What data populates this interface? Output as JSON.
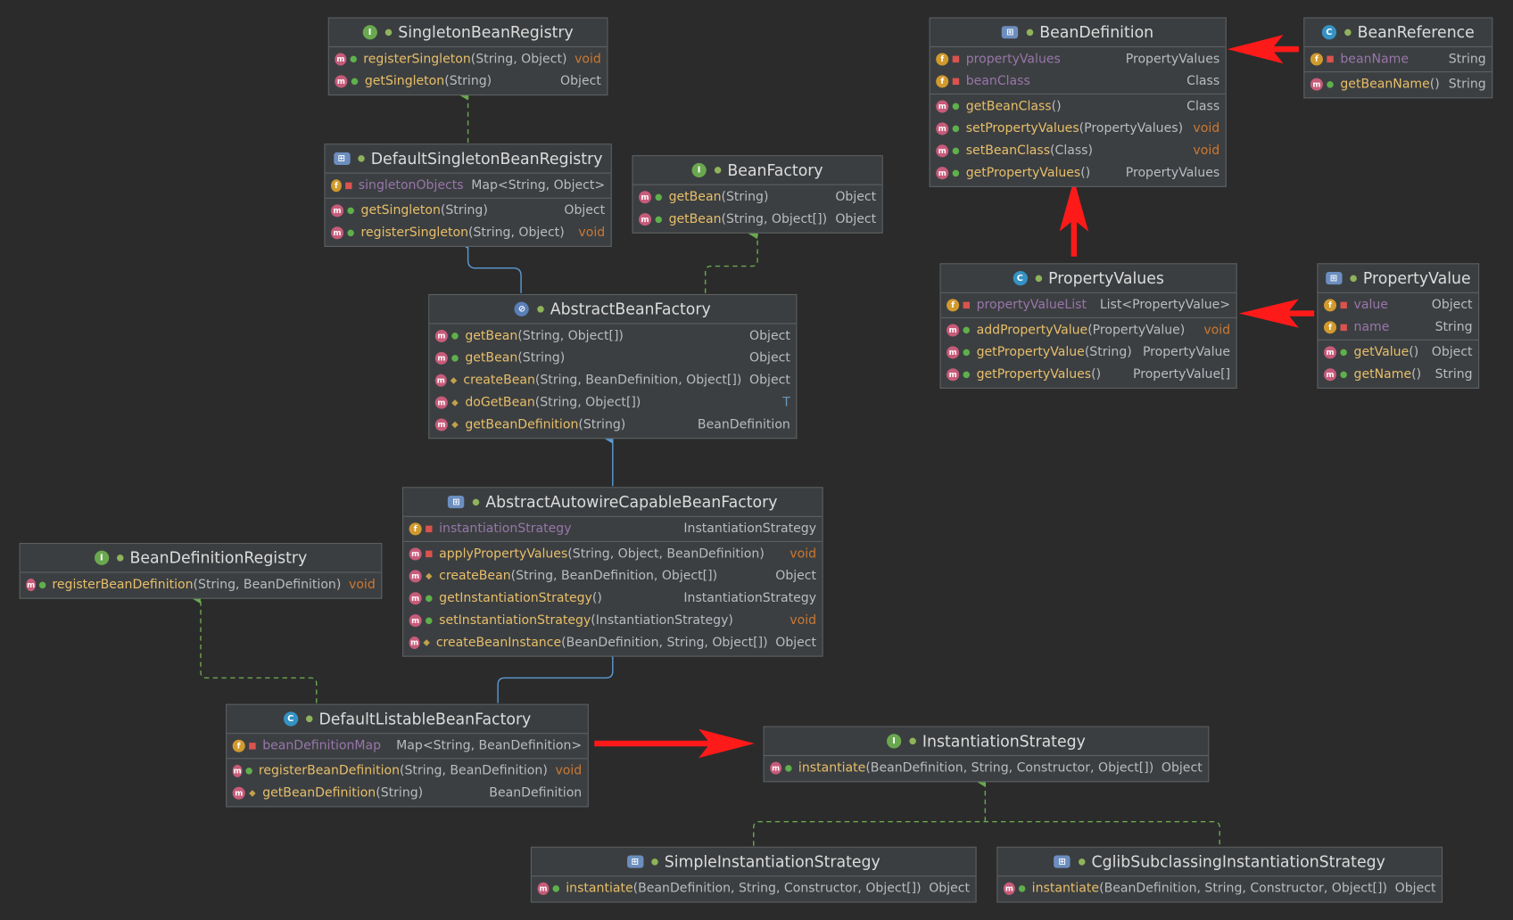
{
  "colors": {
    "background": "#2b2b2b",
    "box": "#3c3f41",
    "method_name": "#e8bf6a",
    "field_name": "#9876aa",
    "void": "#cc7832",
    "realization_edge": "#6aa84f",
    "generalization_edge": "#5b9bd5",
    "annotation_arrow": "#ff1a1a"
  },
  "icons": {
    "interface": "interface-icon",
    "class": "class-icon",
    "abstract": "abstract-class-icon",
    "method": "method-icon",
    "field": "field-icon"
  },
  "boxes": {
    "singletonRegistry": {
      "title": "SingletonBeanRegistry",
      "kind": "I",
      "rows": [
        {
          "mk": "m",
          "vis": "pub",
          "name": "registerSingleton",
          "args": "(String, Object)",
          "rt": "void"
        },
        {
          "mk": "m",
          "vis": "pub",
          "name": "getSingleton",
          "args": "(String)",
          "rt": "Object"
        }
      ]
    },
    "defaultSingleton": {
      "title": "DefaultSingletonBeanRegistry",
      "kind": "A",
      "fields": [
        {
          "mk": "f",
          "vis": "priv",
          "name": "singletonObjects",
          "args": "",
          "rt": "Map<String, Object>"
        }
      ],
      "rows": [
        {
          "mk": "m",
          "vis": "pub",
          "name": "getSingleton",
          "args": "(String)",
          "rt": "Object"
        },
        {
          "mk": "m",
          "vis": "pub",
          "name": "registerSingleton",
          "args": "(String, Object)",
          "rt": "void"
        }
      ]
    },
    "beanFactory": {
      "title": "BeanFactory",
      "kind": "I",
      "rows": [
        {
          "mk": "m",
          "vis": "pub",
          "name": "getBean",
          "args": "(String)",
          "rt": "Object"
        },
        {
          "mk": "m",
          "vis": "pub",
          "name": "getBean",
          "args": "(String, Object[])",
          "rt": "Object"
        }
      ]
    },
    "abstractBeanFactory": {
      "title": "AbstractBeanFactory",
      "kind": "AB",
      "rows": [
        {
          "mk": "m",
          "vis": "pub",
          "name": "getBean",
          "args": "(String, Object[])",
          "rt": "Object"
        },
        {
          "mk": "m",
          "vis": "pub",
          "name": "getBean",
          "args": "(String)",
          "rt": "Object"
        },
        {
          "mk": "m",
          "vis": "prot",
          "name": "createBean",
          "args": "(String, BeanDefinition, Object[])",
          "rt": "Object"
        },
        {
          "mk": "m",
          "vis": "prot",
          "name": "doGetBean",
          "args": "(String, Object[])",
          "rt": "T"
        },
        {
          "mk": "m",
          "vis": "prot",
          "name": "getBeanDefinition",
          "args": "(String)",
          "rt": "BeanDefinition"
        }
      ]
    },
    "abstractAutowire": {
      "title": "AbstractAutowireCapableBeanFactory",
      "kind": "A",
      "fields": [
        {
          "mk": "f",
          "vis": "priv",
          "name": "instantiationStrategy",
          "args": "",
          "rt": "InstantiationStrategy"
        }
      ],
      "rows": [
        {
          "mk": "m",
          "vis": "priv",
          "name": "applyPropertyValues",
          "args": "(String, Object, BeanDefinition)",
          "rt": "void"
        },
        {
          "mk": "m",
          "vis": "prot",
          "name": "createBean",
          "args": "(String, BeanDefinition, Object[])",
          "rt": "Object"
        },
        {
          "mk": "m",
          "vis": "pub",
          "name": "getInstantiationStrategy",
          "args": "()",
          "rt": "InstantiationStrategy"
        },
        {
          "mk": "m",
          "vis": "pub",
          "name": "setInstantiationStrategy",
          "args": "(InstantiationStrategy)",
          "rt": "void"
        },
        {
          "mk": "m",
          "vis": "prot",
          "name": "createBeanInstance",
          "args": "(BeanDefinition, String, Object[])",
          "rt": "Object"
        }
      ]
    },
    "beanDefinitionRegistry": {
      "title": "BeanDefinitionRegistry",
      "kind": "I",
      "rows": [
        {
          "mk": "m",
          "vis": "pub",
          "name": "registerBeanDefinition",
          "args": "(String, BeanDefinition)",
          "rt": "void"
        }
      ]
    },
    "defaultListable": {
      "title": "DefaultListableBeanFactory",
      "kind": "C",
      "fields": [
        {
          "mk": "f",
          "vis": "priv",
          "name": "beanDefinitionMap",
          "args": "",
          "rt": "Map<String, BeanDefinition>"
        }
      ],
      "rows": [
        {
          "mk": "m",
          "vis": "pub",
          "name": "registerBeanDefinition",
          "args": "(String, BeanDefinition)",
          "rt": "void"
        },
        {
          "mk": "m",
          "vis": "prot",
          "name": "getBeanDefinition",
          "args": "(String)",
          "rt": "BeanDefinition"
        }
      ]
    },
    "instantiationStrategy": {
      "title": "InstantiationStrategy",
      "kind": "I",
      "rows": [
        {
          "mk": "m",
          "vis": "pub",
          "name": "instantiate",
          "args": "(BeanDefinition, String, Constructor, Object[])",
          "rt": "Object"
        }
      ]
    },
    "simpleInst": {
      "title": "SimpleInstantiationStrategy",
      "kind": "A",
      "rows": [
        {
          "mk": "m",
          "vis": "pub",
          "name": "instantiate",
          "args": "(BeanDefinition, String, Constructor, Object[])",
          "rt": "Object"
        }
      ]
    },
    "cglibInst": {
      "title": "CglibSubclassingInstantiationStrategy",
      "kind": "A",
      "rows": [
        {
          "mk": "m",
          "vis": "pub",
          "name": "instantiate",
          "args": "(BeanDefinition, String, Constructor, Object[])",
          "rt": "Object"
        }
      ]
    },
    "beanDefinition": {
      "title": "BeanDefinition",
      "kind": "A",
      "fields": [
        {
          "mk": "f",
          "vis": "priv",
          "name": "propertyValues",
          "args": "",
          "rt": "PropertyValues"
        },
        {
          "mk": "f",
          "vis": "priv",
          "name": "beanClass",
          "args": "",
          "rt": "Class"
        }
      ],
      "rows": [
        {
          "mk": "m",
          "vis": "pub",
          "name": "getBeanClass",
          "args": "()",
          "rt": "Class"
        },
        {
          "mk": "m",
          "vis": "pub",
          "name": "setPropertyValues",
          "args": "(PropertyValues)",
          "rt": "void"
        },
        {
          "mk": "m",
          "vis": "pub",
          "name": "setBeanClass",
          "args": "(Class)",
          "rt": "void"
        },
        {
          "mk": "m",
          "vis": "pub",
          "name": "getPropertyValues",
          "args": "()",
          "rt": "PropertyValues"
        }
      ]
    },
    "beanReference": {
      "title": "BeanReference",
      "kind": "C",
      "fields": [
        {
          "mk": "f",
          "vis": "priv",
          "name": "beanName",
          "args": "",
          "rt": "String"
        }
      ],
      "rows": [
        {
          "mk": "m",
          "vis": "pub",
          "name": "getBeanName",
          "args": "()",
          "rt": "String"
        }
      ]
    },
    "propertyValues": {
      "title": "PropertyValues",
      "kind": "C",
      "fields": [
        {
          "mk": "f",
          "vis": "priv",
          "name": "propertyValueList",
          "args": "",
          "rt": "List<PropertyValue>"
        }
      ],
      "rows": [
        {
          "mk": "m",
          "vis": "pub",
          "name": "addPropertyValue",
          "args": "(PropertyValue)",
          "rt": "void"
        },
        {
          "mk": "m",
          "vis": "pub",
          "name": "getPropertyValue",
          "args": "(String)",
          "rt": "PropertyValue"
        },
        {
          "mk": "m",
          "vis": "pub",
          "name": "getPropertyValues",
          "args": "()",
          "rt": "PropertyValue[]"
        }
      ]
    },
    "propertyValue": {
      "title": "PropertyValue",
      "kind": "A",
      "fields": [
        {
          "mk": "f",
          "vis": "priv",
          "name": "value",
          "args": "",
          "rt": "Object"
        },
        {
          "mk": "f",
          "vis": "priv",
          "name": "name",
          "args": "",
          "rt": "String"
        }
      ],
      "rows": [
        {
          "mk": "m",
          "vis": "pub",
          "name": "getValue",
          "args": "()",
          "rt": "Object"
        },
        {
          "mk": "m",
          "vis": "pub",
          "name": "getName",
          "args": "()",
          "rt": "String"
        }
      ]
    }
  }
}
